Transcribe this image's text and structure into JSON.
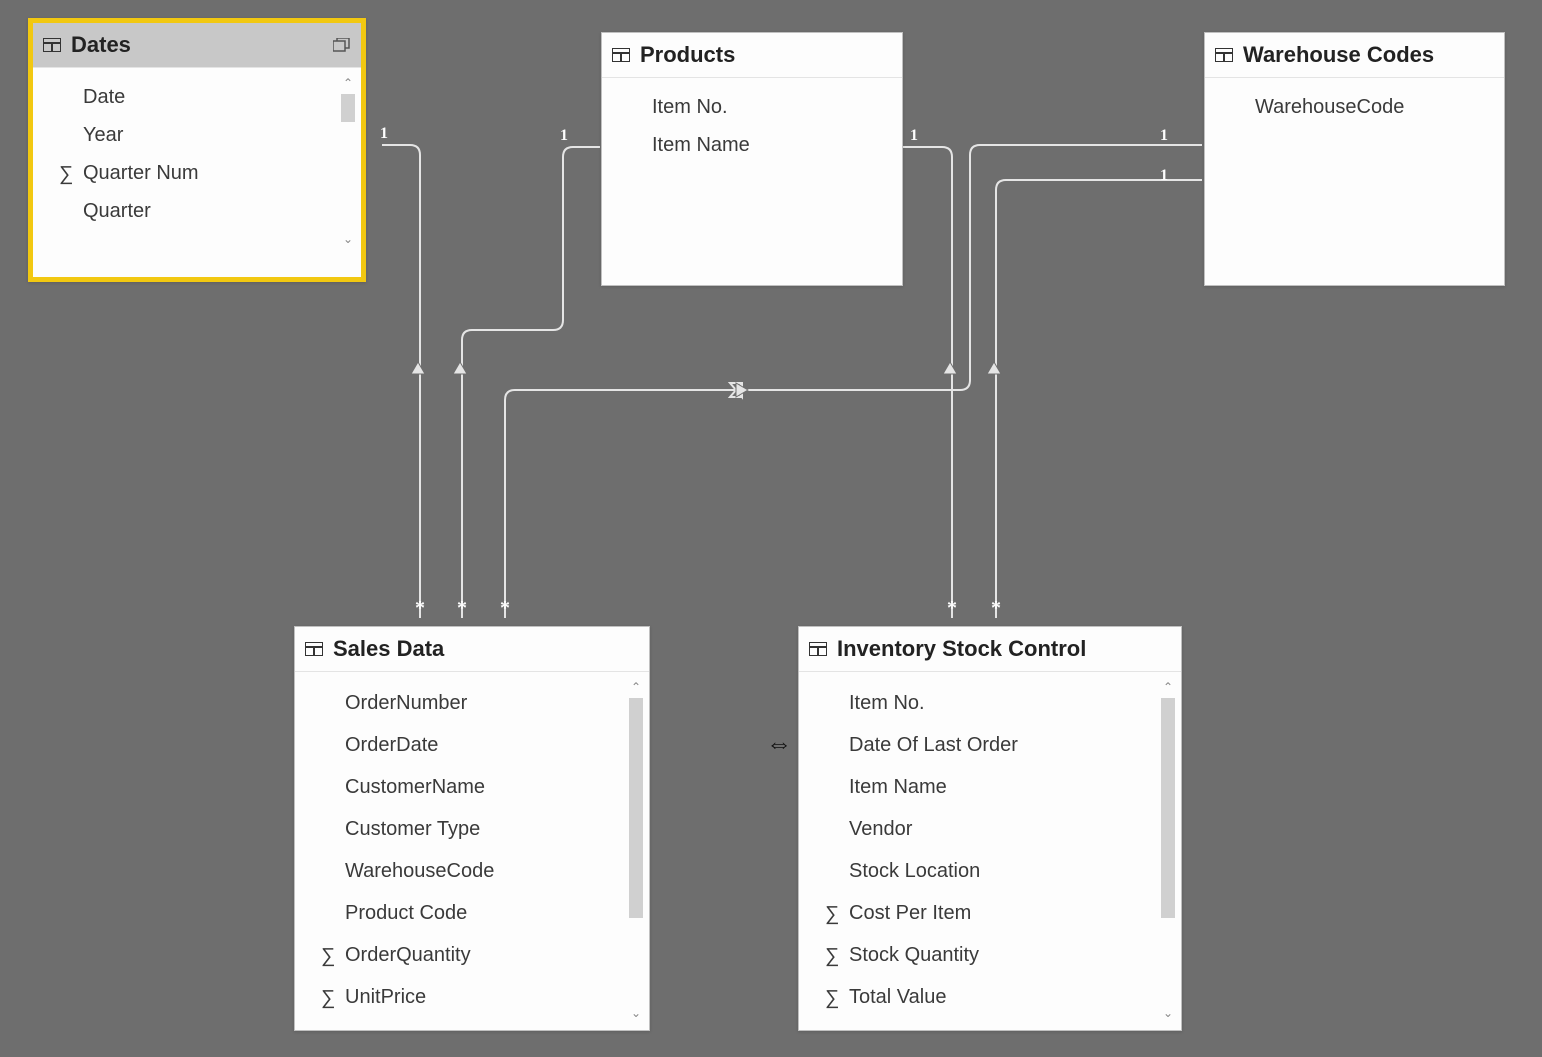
{
  "tables": {
    "dates": {
      "title": "Dates",
      "selected": true,
      "fields": [
        {
          "label": "Date"
        },
        {
          "label": "Year"
        },
        {
          "label": "Quarter Num",
          "sigma": true
        },
        {
          "label": "Quarter"
        }
      ]
    },
    "products": {
      "title": "Products",
      "fields": [
        {
          "label": "Item No."
        },
        {
          "label": "Item Name"
        }
      ]
    },
    "warehouse": {
      "title": "Warehouse Codes",
      "fields": [
        {
          "label": "WarehouseCode"
        }
      ]
    },
    "sales": {
      "title": "Sales Data",
      "fields": [
        {
          "label": "OrderNumber"
        },
        {
          "label": "OrderDate"
        },
        {
          "label": "CustomerName"
        },
        {
          "label": "Customer Type"
        },
        {
          "label": "WarehouseCode"
        },
        {
          "label": "Product Code"
        },
        {
          "label": "OrderQuantity",
          "sigma": true
        },
        {
          "label": "UnitPrice",
          "sigma": true
        }
      ]
    },
    "inventory": {
      "title": "Inventory Stock Control",
      "fields": [
        {
          "label": "Item No."
        },
        {
          "label": "Date Of Last Order"
        },
        {
          "label": "Item Name"
        },
        {
          "label": "Vendor"
        },
        {
          "label": "Stock Location"
        },
        {
          "label": "Cost Per Item",
          "sigma": true
        },
        {
          "label": "Stock Quantity",
          "sigma": true
        },
        {
          "label": "Total Value",
          "sigma": true
        }
      ]
    }
  },
  "relationships": [
    {
      "from": "dates",
      "to": "sales",
      "fromCard": "1",
      "toCard": "*"
    },
    {
      "from": "products",
      "to": "sales",
      "fromCard": "1",
      "toCard": "*"
    },
    {
      "from": "products",
      "to": "inventory",
      "fromCard": "1",
      "toCard": "*"
    },
    {
      "from": "warehouse",
      "to": "sales",
      "fromCard": "1",
      "toCard": "*"
    },
    {
      "from": "warehouse",
      "to": "inventory",
      "fromCard": "1",
      "toCard": "*"
    }
  ],
  "cardinality": {
    "one": "1",
    "many": "*"
  }
}
